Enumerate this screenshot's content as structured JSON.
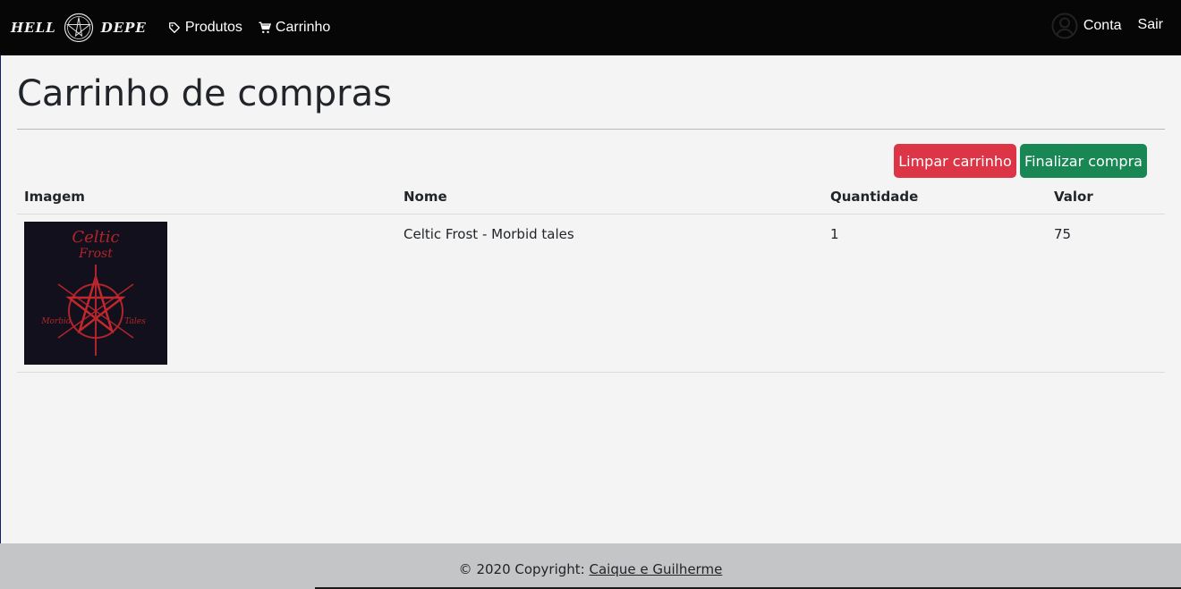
{
  "navbar": {
    "brand_left": "HELL",
    "brand_right": "DEPE",
    "links": [
      {
        "label": "Produtos",
        "icon": "tag-icon"
      },
      {
        "label": "Carrinho",
        "icon": "cart-icon"
      }
    ],
    "account_label": "Conta",
    "logout_label": "Sair"
  },
  "page": {
    "title": "Carrinho de compras"
  },
  "actions": {
    "clear_label": "Limpar carrinho",
    "checkout_label": "Finalizar compra"
  },
  "table": {
    "headers": [
      "Imagem",
      "Nome",
      "Quantidade",
      "Valor"
    ],
    "rows": [
      {
        "name": "Celtic Frost - Morbid tales",
        "quantity": "1",
        "value": "75",
        "image_text_top": "Celtic",
        "image_text_sub": "Frost",
        "image_text_left": "Morbid",
        "image_text_right": "Tales"
      }
    ]
  },
  "footer": {
    "copyright": "© 2020 Copyright: ",
    "link_label": "Caique e Guilherme"
  },
  "colors": {
    "navbar_bg": "#060606",
    "danger": "#dc3545",
    "success": "#198754",
    "footer_bg": "#c4c5c7",
    "page_bg": "#f4f4f4"
  }
}
